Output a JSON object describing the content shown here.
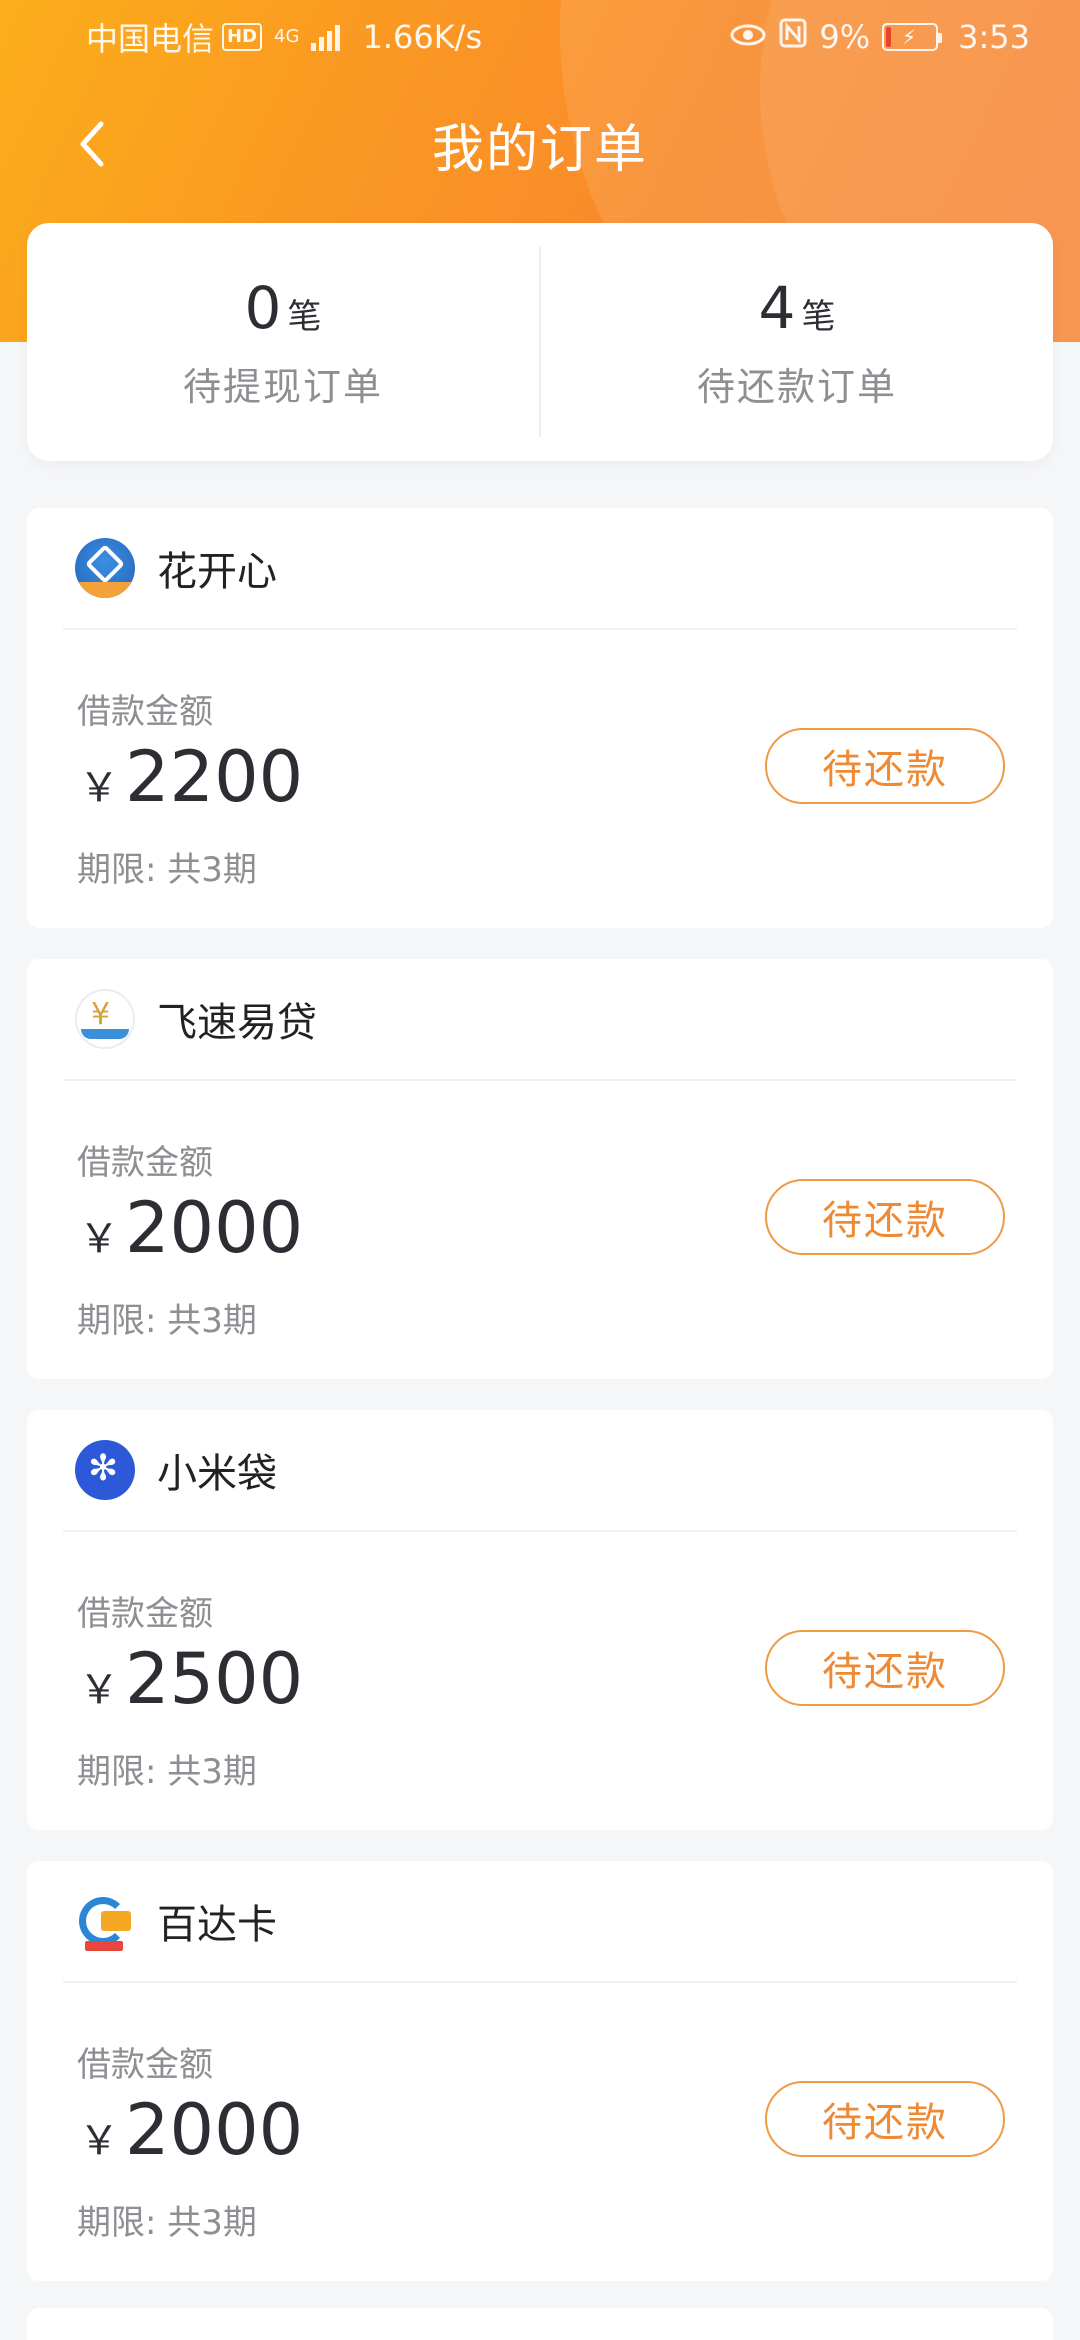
{
  "status_bar": {
    "carrier": "中国电信",
    "hd_badge": "HD",
    "network": "4G",
    "speed": "1.66K/s",
    "battery_percent": "9%",
    "time": "3:53",
    "icons": [
      "hd-badge",
      "signal-icon",
      "eye-icon",
      "nfc-icon",
      "battery-icon"
    ]
  },
  "nav": {
    "title": "我的订单",
    "back_icon": "chevron-left-icon"
  },
  "summary": {
    "pending_withdraw": {
      "count": "0",
      "unit": "笔",
      "label": "待提现订单"
    },
    "pending_repay": {
      "count": "4",
      "unit": "笔",
      "label": "待还款订单"
    }
  },
  "orders": [
    {
      "lender": "花开心",
      "logo_icon": "huakaixin-logo-icon",
      "amount_label": "借款金额",
      "currency": "￥",
      "amount": "2200",
      "term": "期限: 共3期",
      "status": "待还款"
    },
    {
      "lender": "飞速易贷",
      "logo_icon": "feisuyidai-logo-icon",
      "amount_label": "借款金额",
      "currency": "￥",
      "amount": "2000",
      "term": "期限: 共3期",
      "status": "待还款"
    },
    {
      "lender": "小米袋",
      "logo_icon": "xiaomidai-logo-icon",
      "amount_label": "借款金额",
      "currency": "￥",
      "amount": "2500",
      "term": "期限: 共3期",
      "status": "待还款"
    },
    {
      "lender": "百达卡",
      "logo_icon": "baidaka-logo-icon",
      "amount_label": "借款金额",
      "currency": "￥",
      "amount": "2000",
      "term": "期限: 共3期",
      "status": "待还款"
    }
  ],
  "colors": {
    "header_gradient_start": "#fbae1a",
    "header_gradient_end": "#f7812f",
    "status_button_border": "#ef9a45",
    "status_button_text": "#ee8a34",
    "page_background": "#f5f6f8"
  }
}
